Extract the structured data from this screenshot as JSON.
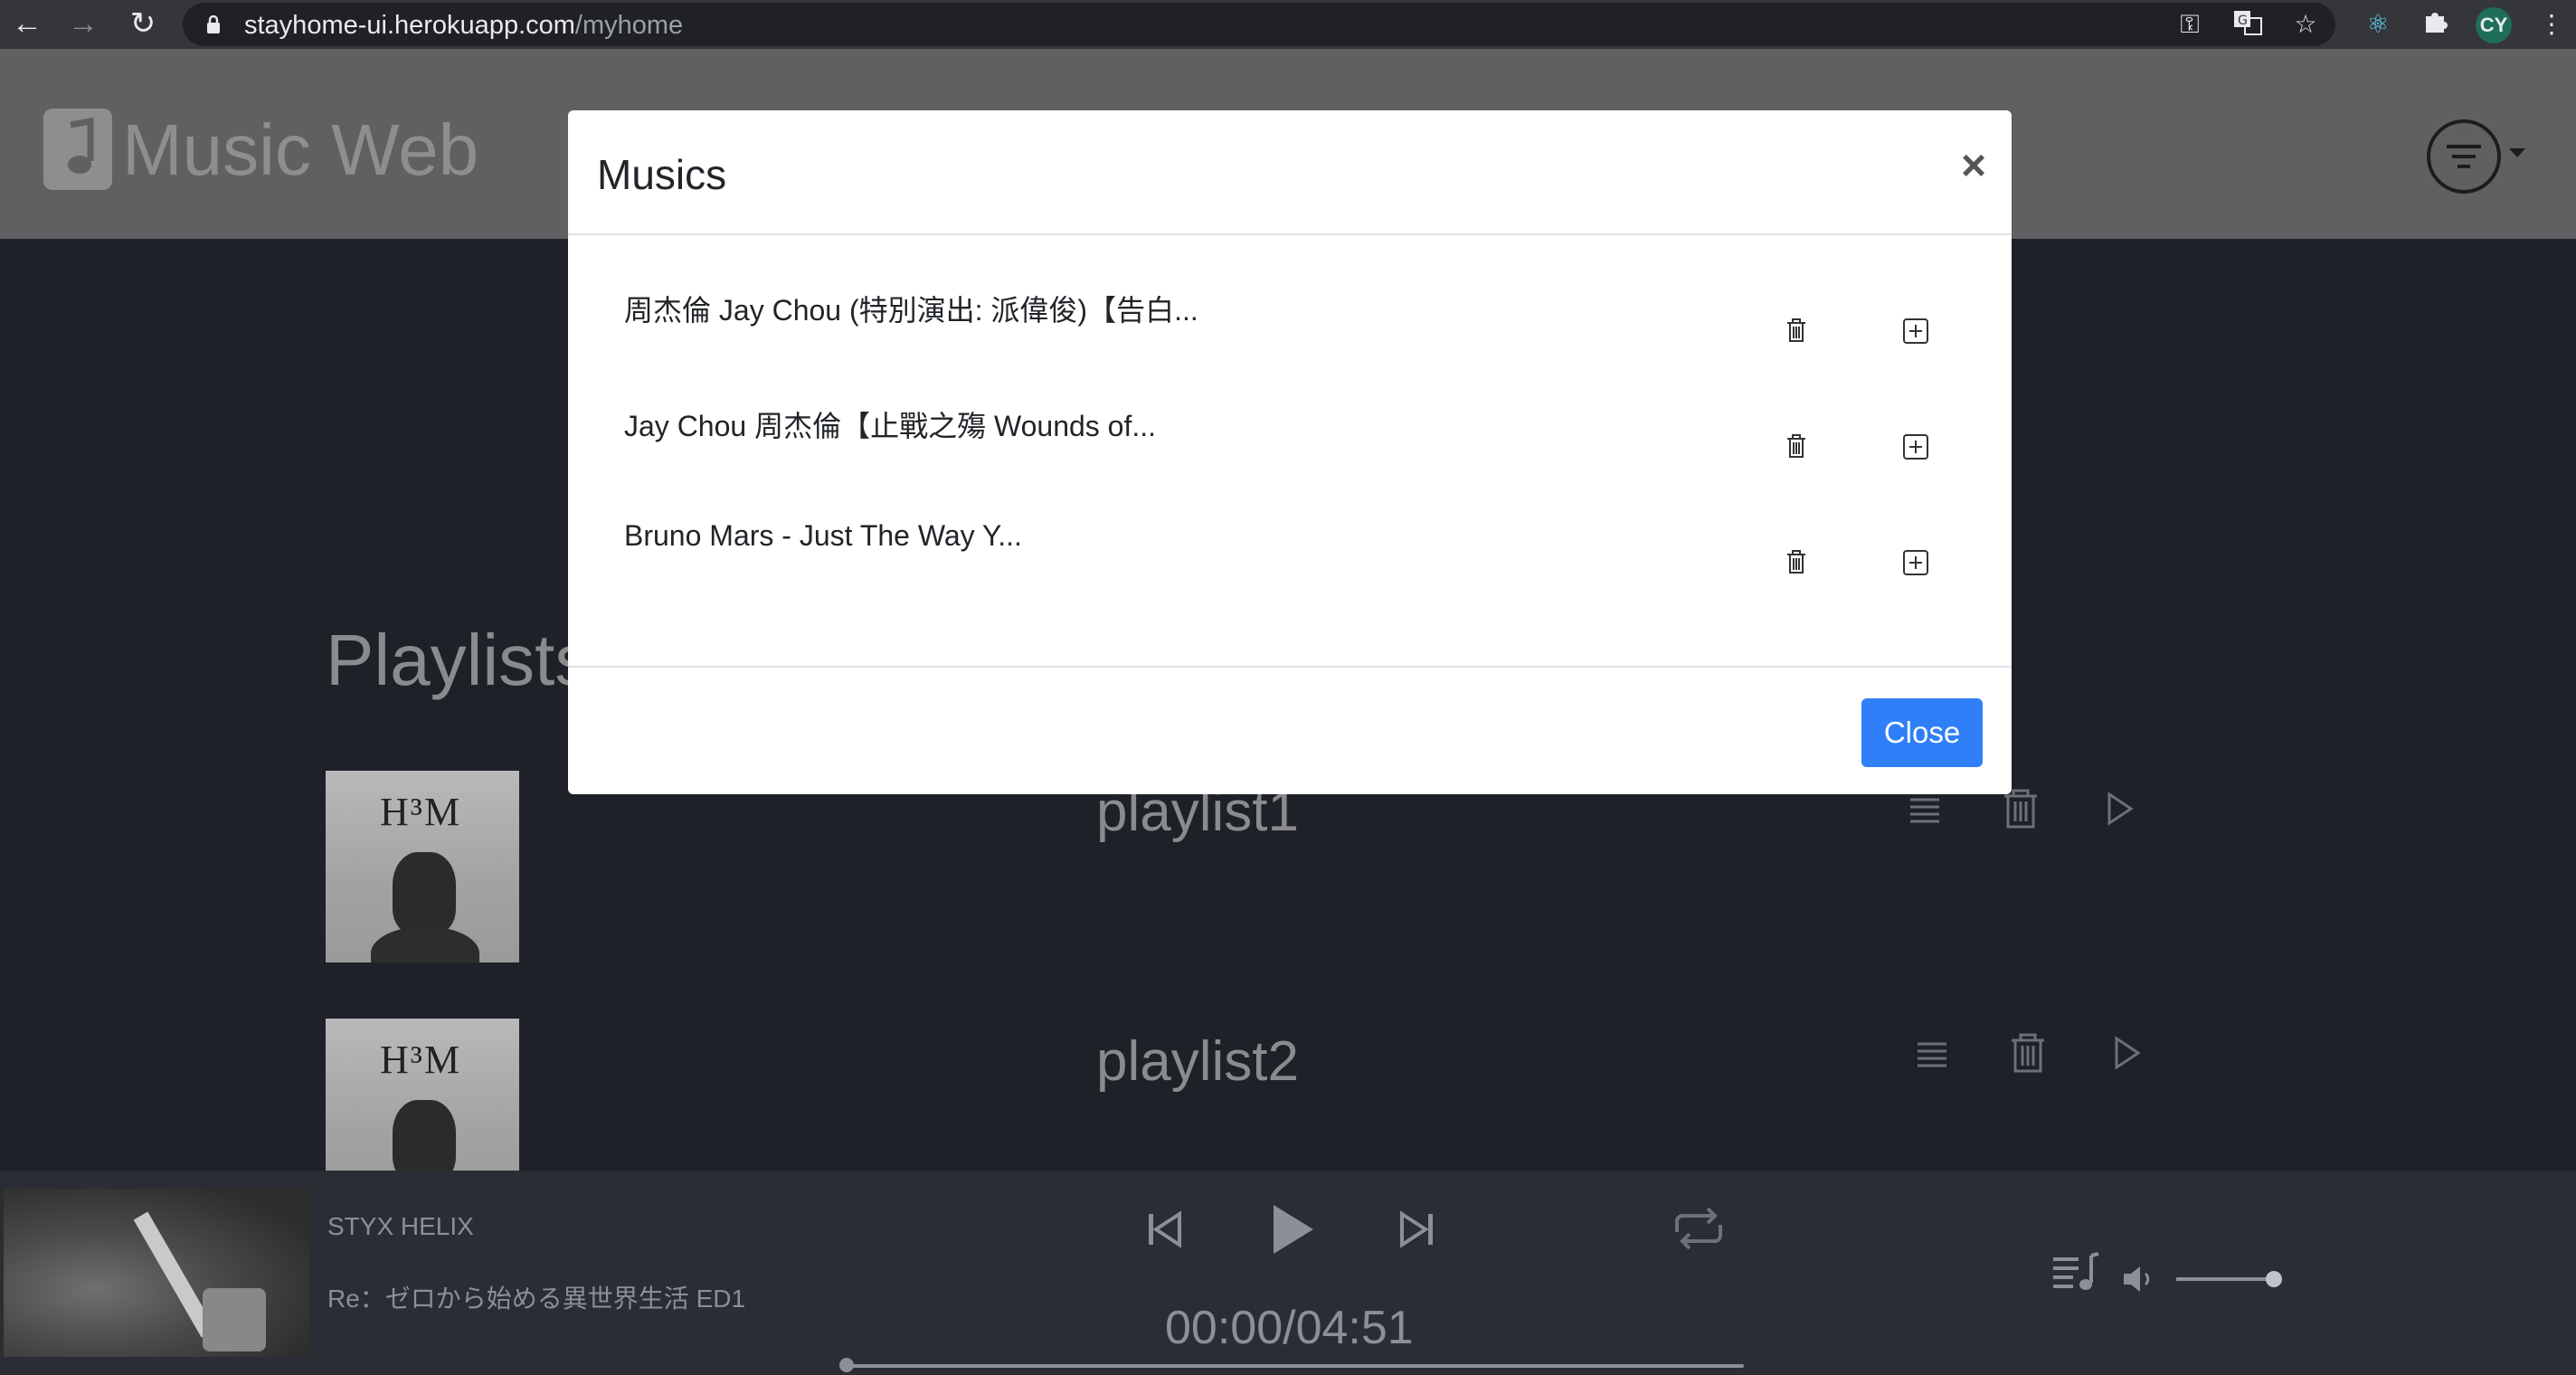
{
  "browser": {
    "url_host": "stayhome-ui.herokuapp.com",
    "url_path": "/myhome",
    "profile_initials": "CY"
  },
  "header": {
    "app_title": "Music Web"
  },
  "page": {
    "section_title": "Playlists",
    "playlists": [
      {
        "name": "playlist1",
        "cover_text": "H³M"
      },
      {
        "name": "playlist2",
        "cover_text": "H³M"
      }
    ]
  },
  "modal": {
    "title": "Musics",
    "close_x": "×",
    "tracks": [
      {
        "title": "周杰倫 Jay Chou (特別演出: 派偉俊)【告白..."
      },
      {
        "title": "Jay Chou 周杰倫【止戰之殤 Wounds of..."
      },
      {
        "title": "Bruno Mars - Just The Way Y..."
      }
    ],
    "close_button": "Close"
  },
  "player": {
    "song_title": "STYX HELIX",
    "song_artist": "Re：ゼロから始める異世界生活 ED1",
    "time_display": "00:00/04:51",
    "progress": 0,
    "volume": 1.0
  },
  "colors": {
    "primary": "#2f7ff8",
    "header_bg": "#5f6061",
    "page_bg": "#1e2127",
    "player_bg": "#2a2d34"
  }
}
